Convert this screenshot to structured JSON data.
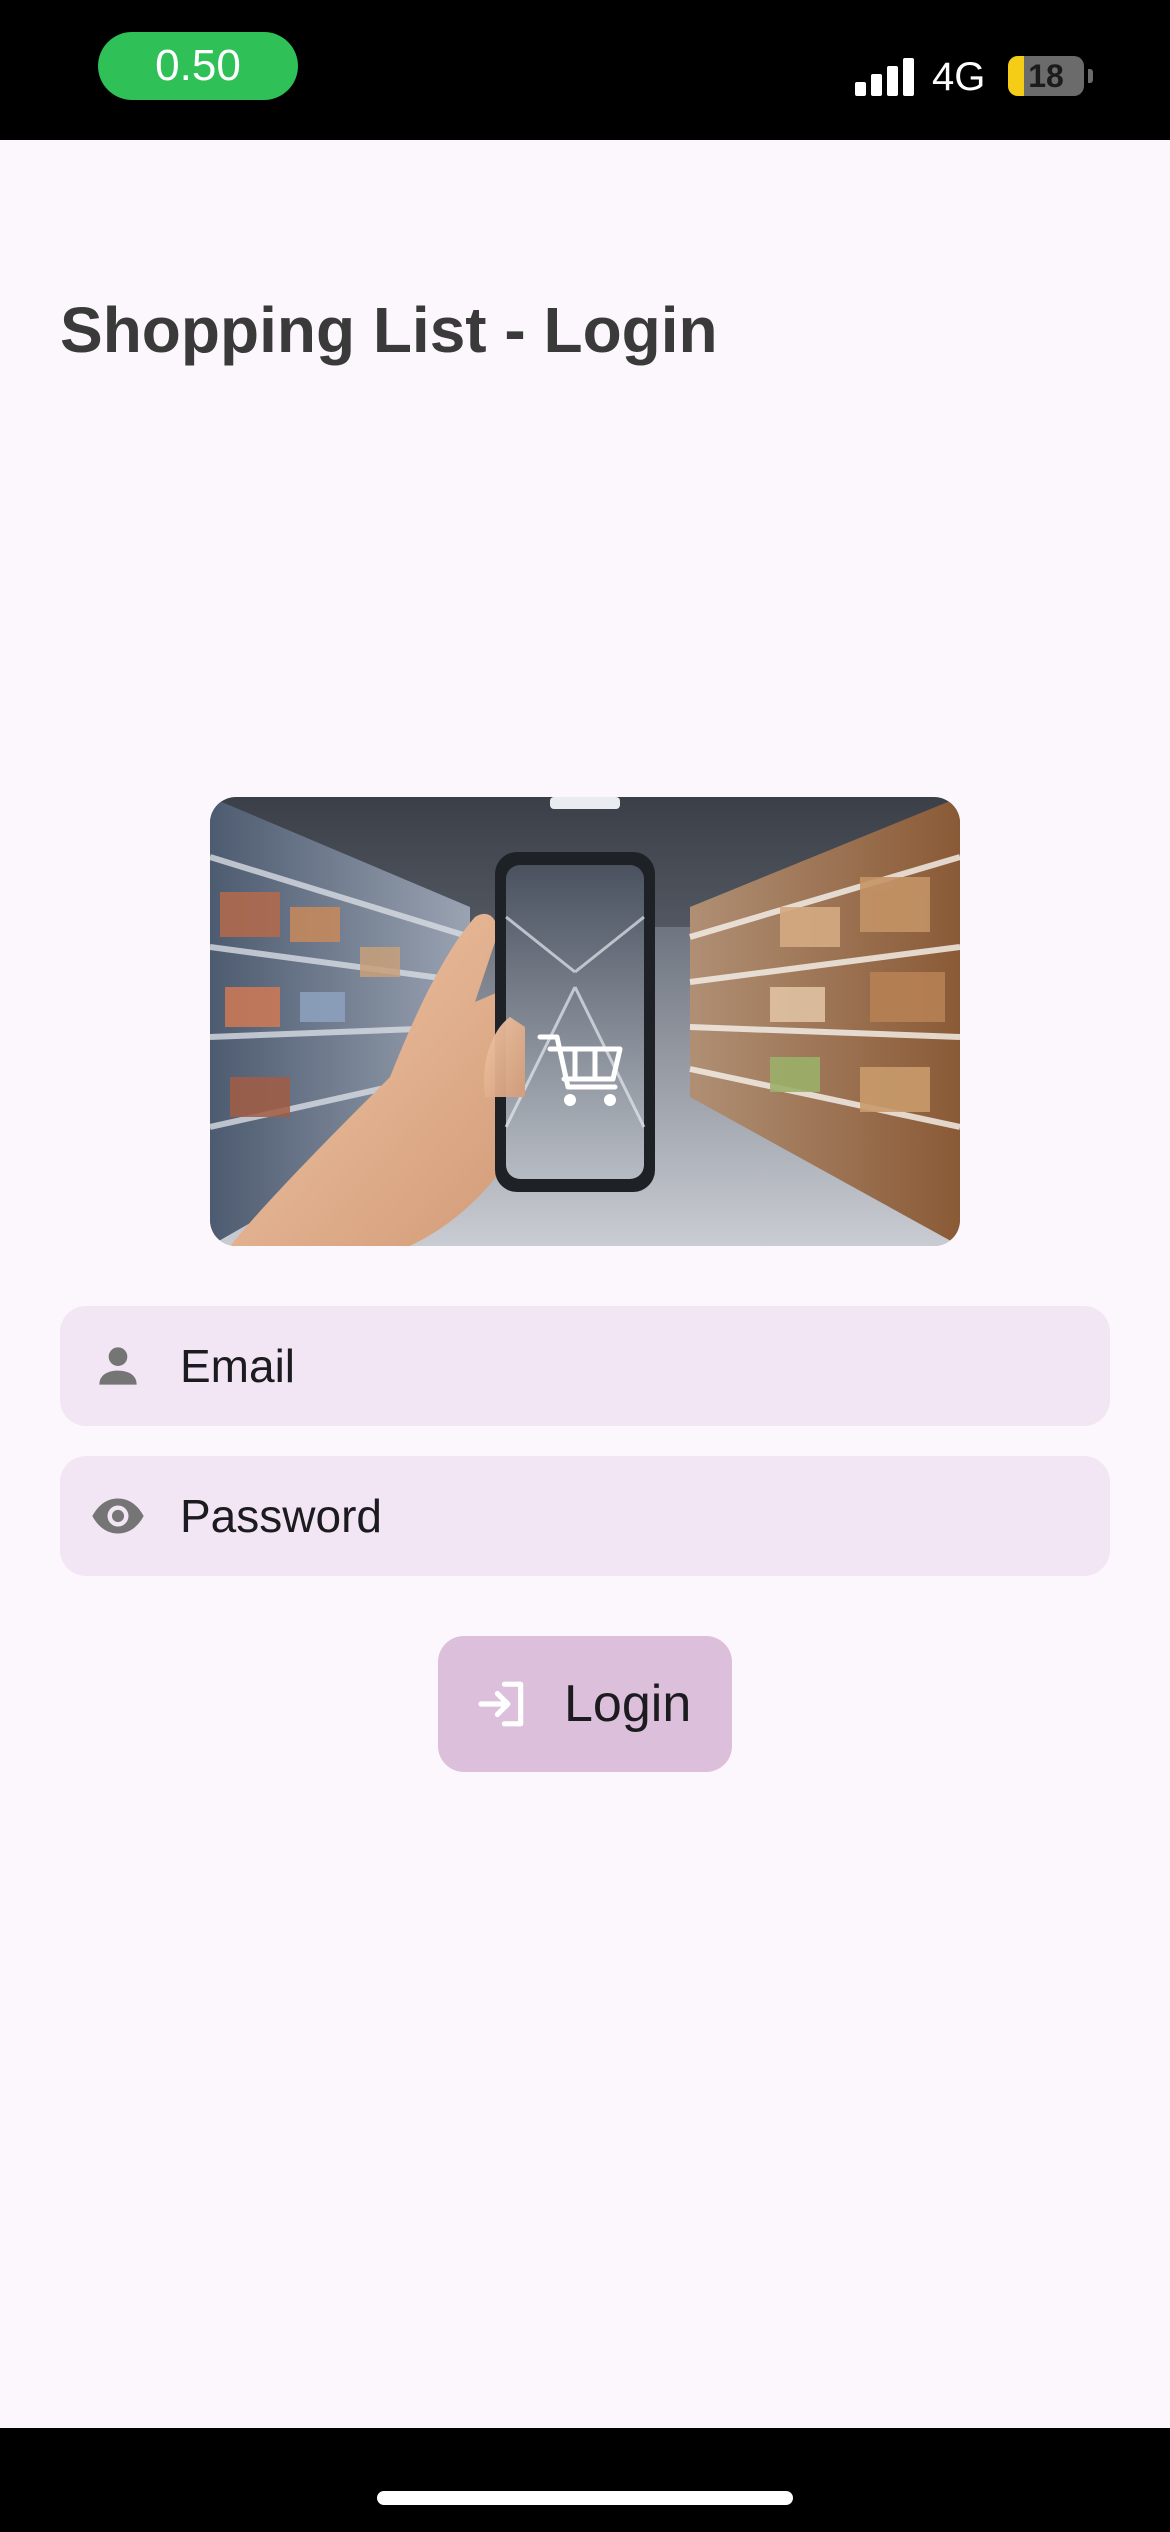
{
  "status_bar": {
    "timer": "0.50",
    "network": "4G",
    "battery": "18"
  },
  "header": {
    "title": "Shopping List - Login"
  },
  "form": {
    "email_placeholder": "Email",
    "email_value": "",
    "password_placeholder": "Password",
    "password_value": "",
    "login_label": "Login"
  },
  "icons": {
    "email": "person-icon",
    "password": "eye-icon",
    "login": "login-arrow-icon"
  },
  "colors": {
    "background": "#fcf6fd",
    "field": "#f3e6f4",
    "button": "#dbbfdb",
    "timer_pill": "#2fc158"
  }
}
